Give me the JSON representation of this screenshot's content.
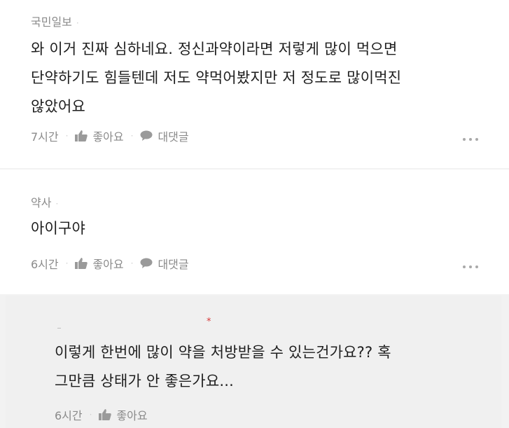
{
  "comments": [
    {
      "author": "국민일보",
      "body_lines": [
        "와 이거 진짜 심하네요. 정신과약이라면 저렇게 많이 먹으면",
        "단약하기도 힘들텐데 저도 약먹어봤지만 저 정도로 많이먹진",
        "않았어요"
      ],
      "time": "7시간",
      "like_label": "좋아요",
      "reply_label": "대댓글"
    },
    {
      "author": "약사",
      "body_lines": [
        "아이구야"
      ],
      "time": "6시간",
      "like_label": "좋아요",
      "reply_label": "대댓글"
    }
  ],
  "reply": {
    "body_lines": [
      "이렇게 한번에 많이 약을 처방받을 수 있는건가요?? 혹",
      "그만큼 상태가 안 좋은가요..."
    ],
    "time": "6시간",
    "like_label": "좋아요"
  },
  "colors": {
    "muted_text": "#8a8a8a",
    "body_text": "#1e1e1e",
    "reply_bg": "#f0f0f0",
    "marker": "#d83a3a"
  }
}
